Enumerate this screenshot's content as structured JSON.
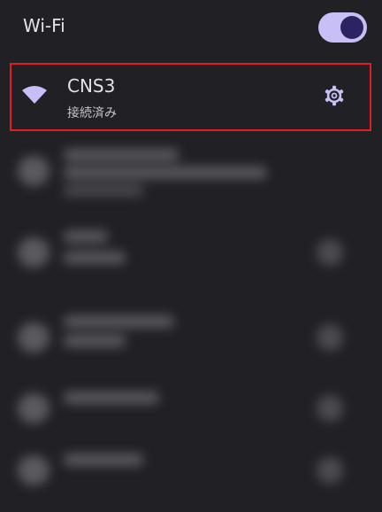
{
  "wifi": {
    "title": "Wi-Fi",
    "enabled": true,
    "toggle_icon": "toggle-on",
    "accent_color": "#c9bff7"
  },
  "connected_network": {
    "name": "CNS3",
    "status": "接続済み",
    "icon": "wifi-icon",
    "settings_icon": "gear-icon",
    "highlight_color": "#e31b23"
  },
  "other_networks": {
    "blurred": true
  }
}
